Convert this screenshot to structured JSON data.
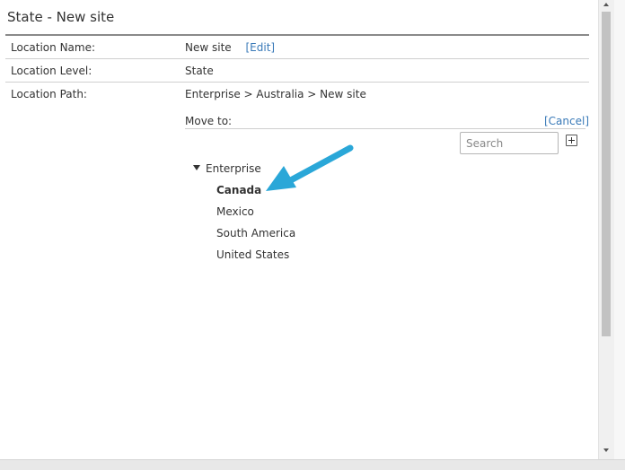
{
  "header": {
    "title": "State - New site"
  },
  "details": {
    "location_name": {
      "label": "Location Name:",
      "value": "New site",
      "edit_link": "[Edit]"
    },
    "location_level": {
      "label": "Location Level:",
      "value": "State"
    },
    "location_path": {
      "label": "Location Path:",
      "value": "Enterprise > Australia > New site"
    }
  },
  "move": {
    "label": "Move to:",
    "cancel_link": "[Cancel]",
    "search_placeholder": "Search",
    "tree": {
      "root": "Enterprise",
      "children": [
        "Canada",
        "Mexico",
        "South America",
        "United States"
      ],
      "selected": "Canada"
    }
  },
  "colors": {
    "link": "#3a7ab8",
    "annotation_arrow": "#2aa7d8",
    "title_rule": "#8a8a8a"
  },
  "icons": [
    "add-icon",
    "expand-triangle-icon",
    "annotation-arrow-icon",
    "scroll-up-icon",
    "scroll-down-icon"
  ]
}
